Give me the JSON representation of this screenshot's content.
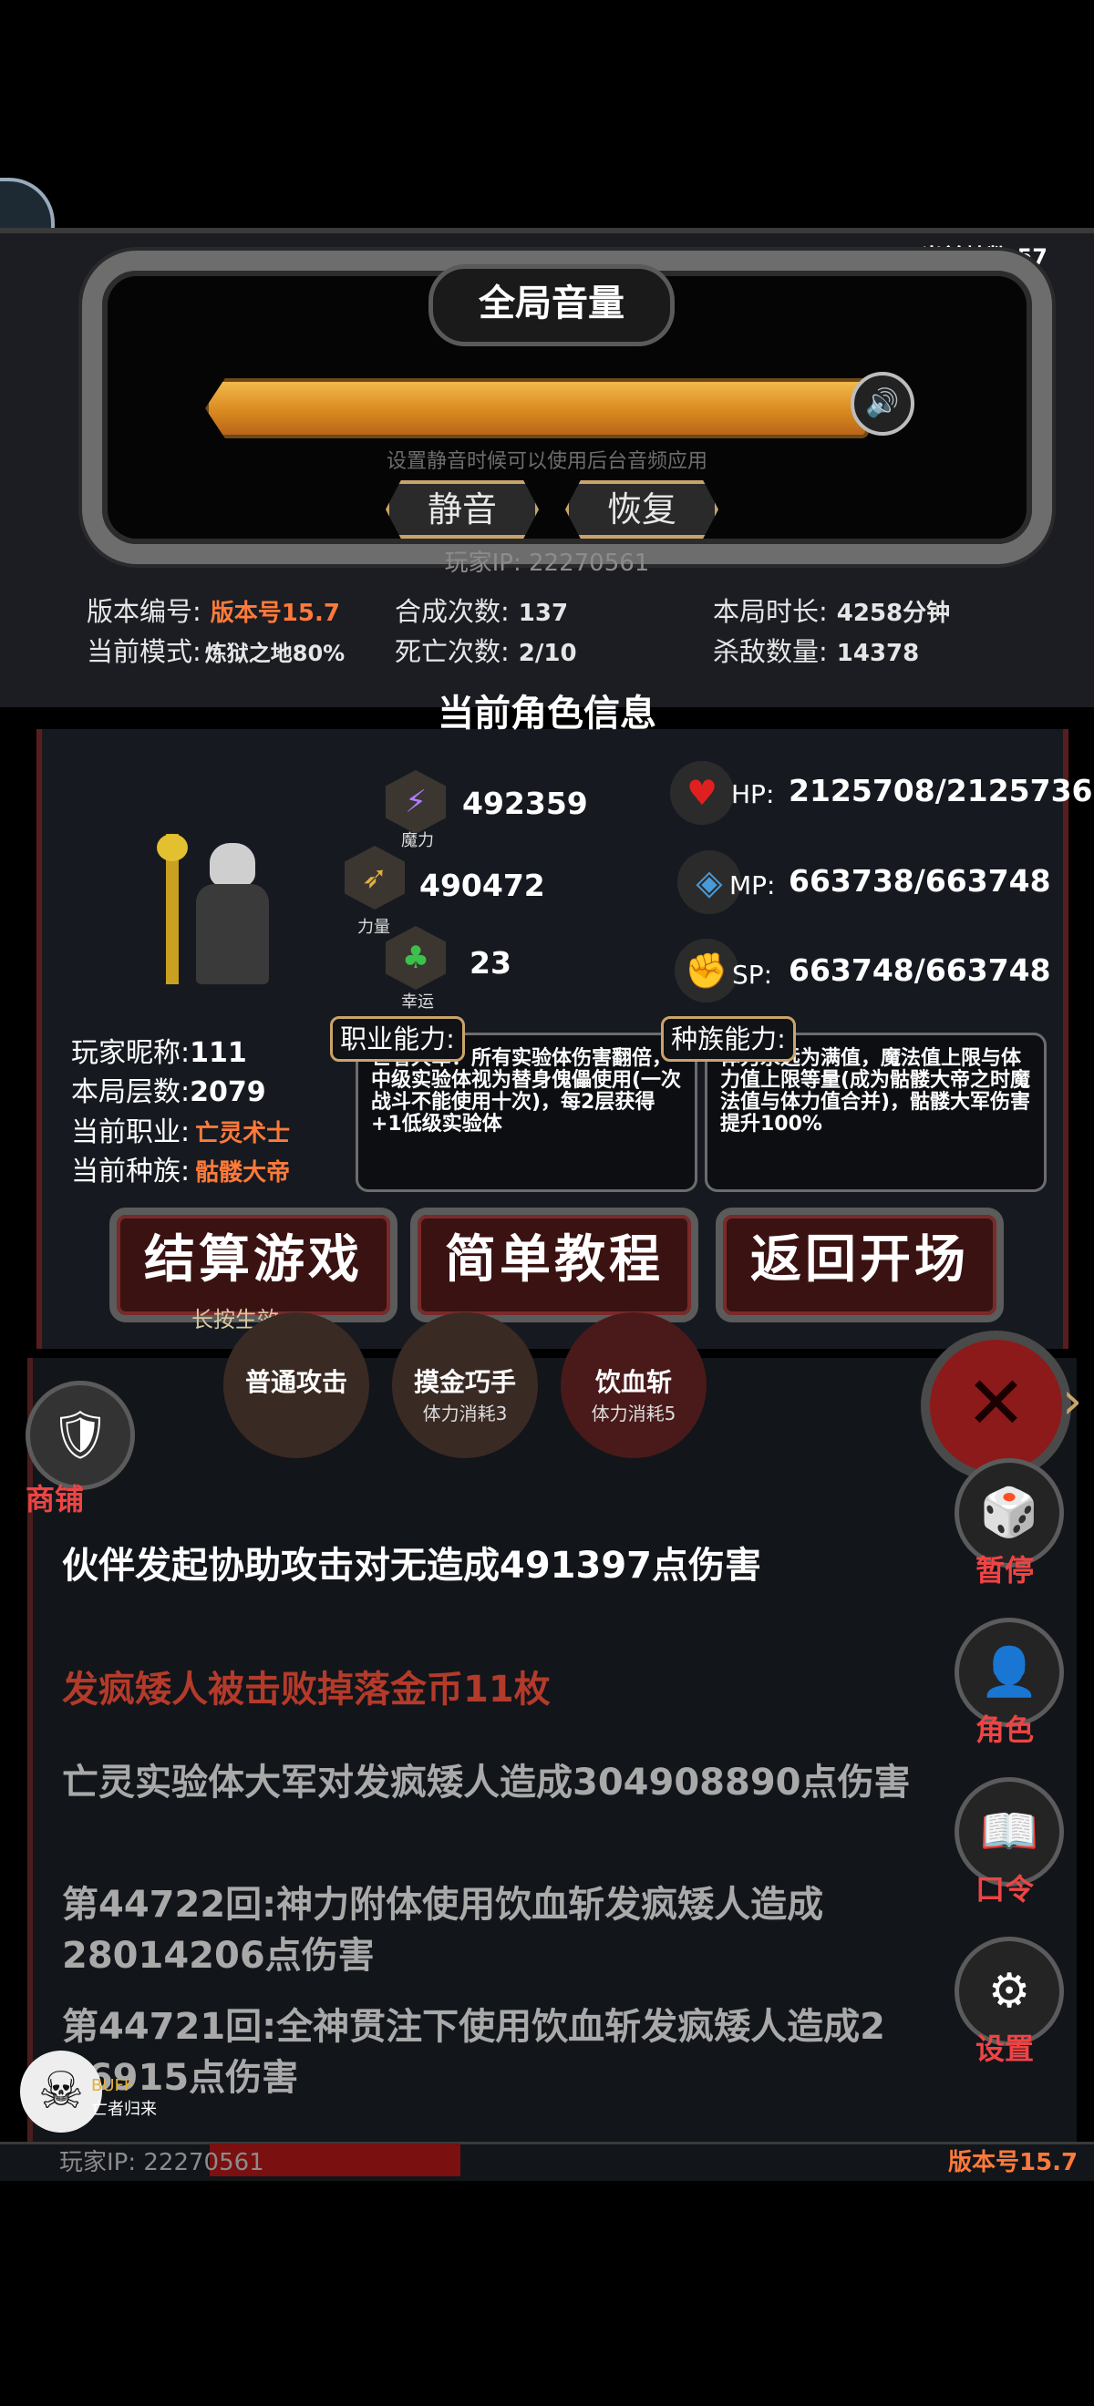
{
  "hud": {
    "fps": "当前帧数:57"
  },
  "volume": {
    "title": "全局音量",
    "level": 1.0,
    "hint": "设置静音时候可以使用后台音频应用",
    "mute_label": "静音",
    "resume_label": "恢复"
  },
  "player_ip": "玩家IP:  22270561",
  "stats": {
    "version_label": "版本编号:",
    "version_value": "版本号15.7",
    "mode_label": "当前模式:",
    "mode_value": "炼狱之地80%",
    "synth_label": "合成次数:",
    "synth_value": "137",
    "death_label": "死亡次数:",
    "death_value": "2/10",
    "duration_label": "本局时长:",
    "duration_value": "4258分钟",
    "kills_label": "杀敌数量:",
    "kills_value": "14378"
  },
  "character": {
    "title": "当前角色信息",
    "magic": "492359",
    "magic_label": "魔力",
    "strength": "490472",
    "strength_label": "力量",
    "luck": "23",
    "luck_label": "幸运",
    "hp_label": "HP:",
    "hp": "2125708/2125736",
    "mp_label": "MP:",
    "mp": "663738/663748",
    "sp_label": "SP:",
    "sp": "663748/663748",
    "nickname_label": "玩家昵称:",
    "nickname": "111",
    "floor_label": "本局层数:",
    "floor": "2079",
    "job_label": "当前职业:",
    "job": "亡灵术士",
    "race_label": "当前种族:",
    "race": "骷髅大帝",
    "job_ability_label": "职业能力:",
    "job_ability": "亡者大军：所有实验体伤害翻倍，中级实验体视为替身傀儡使用(一次战斗不能使用十次)，每2层获得+1低级实验体",
    "race_ability_label": "种族能力:",
    "race_ability": "体力永远为满值，魔法值上限与体力值上限等量(成为骷髅大帝之时魔法值与体力值合并)，骷髅大军伤害提升100%"
  },
  "actions": {
    "settle": "结算游戏",
    "settle_hint": "长按生效",
    "tutorial": "简单教程",
    "return": "返回开场"
  },
  "skills": [
    {
      "name": "普通攻击",
      "cost": ""
    },
    {
      "name": "摸金巧手",
      "cost": "体力消耗3"
    },
    {
      "name": "饮血斩",
      "cost": "体力消耗5"
    }
  ],
  "shop_label": "商铺",
  "side_menu": {
    "pause": "暂停",
    "role": "角色",
    "code": "口令",
    "settings": "设置"
  },
  "logs": [
    "伙伴发起协助攻击对无造成491397点伤害",
    "发疯矮人被击败掉落金币11枚",
    "亡灵实验体大军对发疯矮人造成304908890点伤害",
    "第44722回:神力附体使用饮血斩发疯矮人造成28014206点伤害",
    "第44721回:全神贯注下使用饮血斩发疯矮人造成2  86915点伤害"
  ],
  "buff": {
    "label": "BUFF",
    "name": "亡者归来"
  },
  "footer": {
    "ip": "玩家IP:  22270561",
    "version": "版本号15.7"
  },
  "colors": {
    "accent": "#ff7a3a",
    "danger": "#e44444",
    "gold": "#c9a46a"
  }
}
